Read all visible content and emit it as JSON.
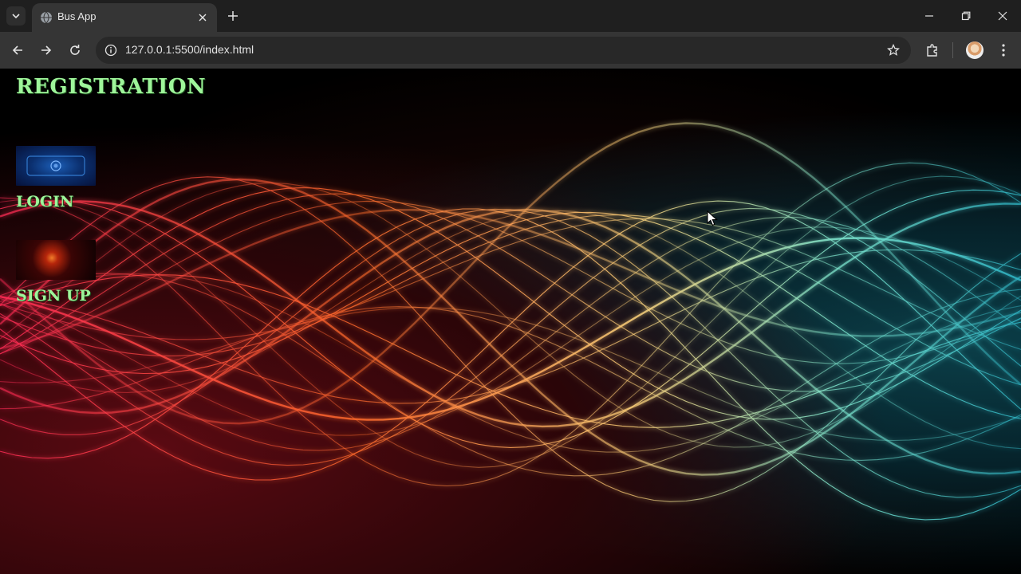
{
  "browser": {
    "tab_title": "Bus App",
    "url": "127.0.0.1:5500/index.html"
  },
  "icons": {
    "tab_search": "chevron-down-icon",
    "favicon": "globe-icon",
    "tab_close": "close-icon",
    "new_tab": "plus-icon",
    "minimize": "minimize-icon",
    "restore": "restore-icon",
    "close_window": "close-icon",
    "back": "back-arrow-icon",
    "forward": "forward-arrow-icon",
    "reload": "reload-icon",
    "site_info": "info-icon",
    "bookmark": "star-icon",
    "extensions": "puzzle-icon",
    "menu": "kebab-menu-icon"
  },
  "page": {
    "heading": "REGISTRATION",
    "login_label": "LOGIN",
    "signup_label": "SIGN UP"
  },
  "colors": {
    "heading_text": "#9ef59a",
    "tab_bar": "#1f1f1f",
    "toolbar": "#353535"
  }
}
